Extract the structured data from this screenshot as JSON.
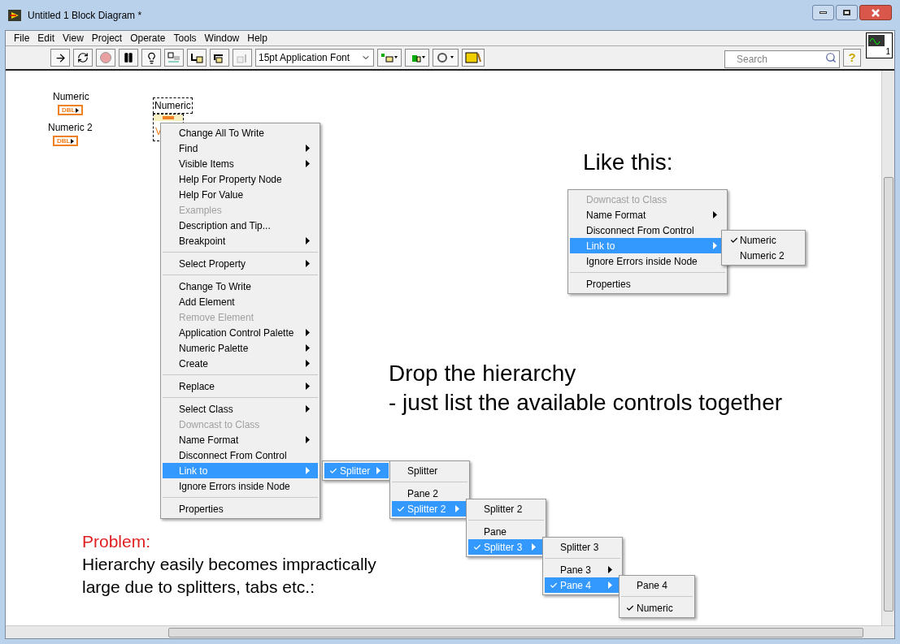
{
  "window": {
    "title": "Untitled 1 Block Diagram *"
  },
  "menu_bar": [
    "File",
    "Edit",
    "View",
    "Project",
    "Operate",
    "Tools",
    "Window",
    "Help"
  ],
  "toolbar": {
    "font_select": "15pt Application Font",
    "search": {
      "placeholder": "Search"
    },
    "context_help": "?",
    "connector_pane_number": "1"
  },
  "diagram": {
    "controls": [
      {
        "label": "Numeric",
        "terminal": "DBL"
      },
      {
        "label": "Numeric 2",
        "terminal": "DBL"
      }
    ],
    "property_node": {
      "label": "Numeric",
      "property": "V"
    },
    "context_menu": [
      {
        "kind": "item",
        "label": "Change All To Write",
        "disabled": false,
        "arrow": false,
        "selected": false
      },
      {
        "kind": "item",
        "label": "Find",
        "disabled": false,
        "arrow": true,
        "selected": false
      },
      {
        "kind": "item",
        "label": "Visible Items",
        "disabled": false,
        "arrow": true,
        "selected": false
      },
      {
        "kind": "item",
        "label": "Help For Property Node",
        "disabled": false,
        "arrow": false,
        "selected": false
      },
      {
        "kind": "item",
        "label": "Help For Value",
        "disabled": false,
        "arrow": false,
        "selected": false
      },
      {
        "kind": "item",
        "label": "Examples",
        "disabled": true,
        "arrow": false,
        "selected": false
      },
      {
        "kind": "item",
        "label": "Description and Tip...",
        "disabled": false,
        "arrow": false,
        "selected": false
      },
      {
        "kind": "item",
        "label": "Breakpoint",
        "disabled": false,
        "arrow": true,
        "selected": false
      },
      {
        "kind": "separator"
      },
      {
        "kind": "item",
        "label": "Select Property",
        "disabled": false,
        "arrow": true,
        "selected": false
      },
      {
        "kind": "separator"
      },
      {
        "kind": "item",
        "label": "Change To Write",
        "disabled": false,
        "arrow": false,
        "selected": false
      },
      {
        "kind": "item",
        "label": "Add Element",
        "disabled": false,
        "arrow": false,
        "selected": false
      },
      {
        "kind": "item",
        "label": "Remove Element",
        "disabled": true,
        "arrow": false,
        "selected": false
      },
      {
        "kind": "item",
        "label": "Application Control Palette",
        "disabled": false,
        "arrow": true,
        "selected": false
      },
      {
        "kind": "item",
        "label": "Numeric Palette",
        "disabled": false,
        "arrow": true,
        "selected": false
      },
      {
        "kind": "item",
        "label": "Create",
        "disabled": false,
        "arrow": true,
        "selected": false
      },
      {
        "kind": "separator"
      },
      {
        "kind": "item",
        "label": "Replace",
        "disabled": false,
        "arrow": true,
        "selected": false
      },
      {
        "kind": "separator"
      },
      {
        "kind": "item",
        "label": "Select Class",
        "disabled": false,
        "arrow": true,
        "selected": false
      },
      {
        "kind": "item",
        "label": "Downcast to Class",
        "disabled": true,
        "arrow": false,
        "selected": false
      },
      {
        "kind": "item",
        "label": "Name Format",
        "disabled": false,
        "arrow": true,
        "selected": false
      },
      {
        "kind": "item",
        "label": "Disconnect From Control",
        "disabled": false,
        "arrow": false,
        "selected": false
      },
      {
        "kind": "item",
        "label": "Link to",
        "disabled": false,
        "arrow": true,
        "selected": true
      },
      {
        "kind": "item",
        "label": "Ignore Errors inside Node",
        "disabled": false,
        "arrow": false,
        "selected": false
      },
      {
        "kind": "separator"
      },
      {
        "kind": "item",
        "label": "Properties",
        "disabled": false,
        "arrow": false,
        "selected": false
      }
    ],
    "cascade": [
      [
        {
          "kind": "item",
          "label": "Splitter",
          "arrow": true,
          "selected": true,
          "checked": true
        }
      ],
      [
        {
          "kind": "item",
          "label": "Splitter",
          "arrow": false,
          "selected": false,
          "checked": false
        },
        {
          "kind": "separator"
        },
        {
          "kind": "item",
          "label": "Pane 2",
          "arrow": false,
          "selected": false,
          "checked": false
        },
        {
          "kind": "item",
          "label": "Splitter 2",
          "arrow": true,
          "selected": true,
          "checked": true
        }
      ],
      [
        {
          "kind": "item",
          "label": "Splitter 2",
          "arrow": false,
          "selected": false,
          "checked": false
        },
        {
          "kind": "separator"
        },
        {
          "kind": "item",
          "label": "Pane",
          "arrow": false,
          "selected": false,
          "checked": false
        },
        {
          "kind": "item",
          "label": "Splitter 3",
          "arrow": true,
          "selected": true,
          "checked": true
        }
      ],
      [
        {
          "kind": "item",
          "label": "Splitter 3",
          "arrow": false,
          "selected": false,
          "checked": false
        },
        {
          "kind": "separator"
        },
        {
          "kind": "item",
          "label": "Pane 3",
          "arrow": true,
          "selected": false,
          "checked": false
        },
        {
          "kind": "item",
          "label": "Pane 4",
          "arrow": true,
          "selected": true,
          "checked": true
        }
      ],
      [
        {
          "kind": "item",
          "label": "Pane 4",
          "arrow": false,
          "selected": false,
          "checked": false
        },
        {
          "kind": "separator"
        },
        {
          "kind": "item",
          "label": "Numeric",
          "arrow": false,
          "selected": false,
          "checked": true
        }
      ]
    ],
    "example": {
      "heading": "Like this:",
      "menu": [
        {
          "kind": "item",
          "label": "Downcast to Class",
          "disabled": true,
          "arrow": false,
          "selected": false
        },
        {
          "kind": "item",
          "label": "Name Format",
          "disabled": false,
          "arrow": true,
          "selected": false
        },
        {
          "kind": "item",
          "label": "Disconnect From Control",
          "disabled": false,
          "arrow": false,
          "selected": false
        },
        {
          "kind": "item",
          "label": "Link to",
          "disabled": false,
          "arrow": true,
          "selected": true
        },
        {
          "kind": "item",
          "label": "Ignore Errors inside Node",
          "disabled": false,
          "arrow": false,
          "selected": false
        },
        {
          "kind": "separator"
        },
        {
          "kind": "item",
          "label": "Properties",
          "disabled": false,
          "arrow": false,
          "selected": false
        }
      ],
      "submenu": [
        {
          "kind": "item",
          "label": "Numeric",
          "arrow": false,
          "selected": false,
          "checked": true
        },
        {
          "kind": "item",
          "label": "Numeric 2",
          "arrow": false,
          "selected": false,
          "checked": false
        }
      ]
    },
    "notes": {
      "suggestion": [
        "Drop the hierarchy",
        "- just list the available controls together"
      ],
      "problem_heading": "Problem:",
      "problem": [
        "Hierarchy easily becomes impractically",
        "large due to splitters, tabs etc.:"
      ]
    }
  }
}
